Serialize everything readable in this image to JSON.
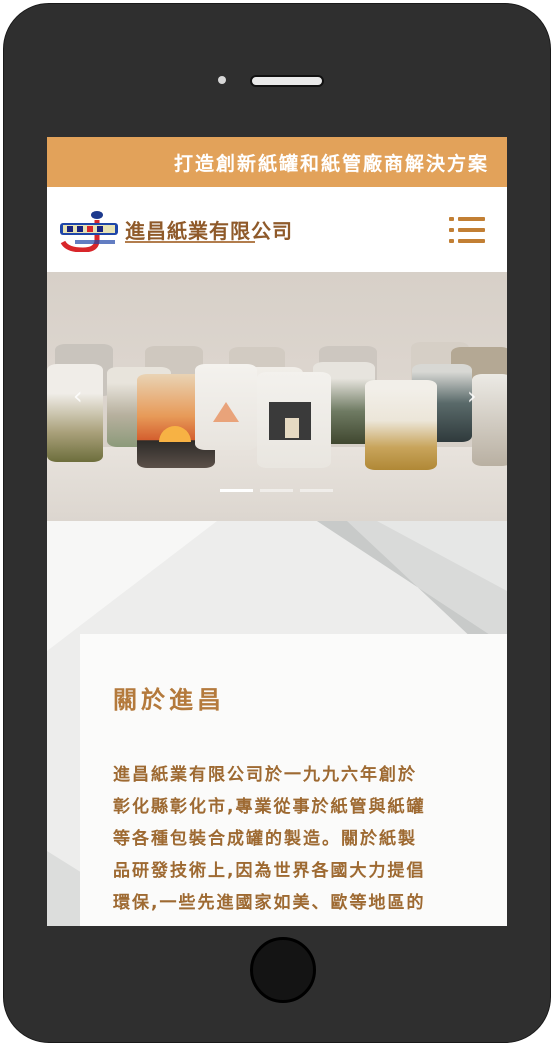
{
  "top_banner": {
    "slogan": "打造創新紙罐和紙管廠商解決方案"
  },
  "header": {
    "logo_text": "進昌紙業有限公司",
    "menu_icon": "hamburger-menu-icon"
  },
  "hero": {
    "prev_icon": "chevron-left-icon",
    "next_icon": "chevron-right-icon",
    "slides_total": 3,
    "active_slide": 1
  },
  "about": {
    "title": "關於進昌",
    "body": "進昌紙業有限公司於一九九六年創於彰化縣彰化市,專業從事於紙管與紙罐等各種包裝合成罐的製造。關於紙製品研發技術上,因為世界各國大力提倡環保,一些先進國家如美、歐等地區的"
  },
  "colors": {
    "accent": "#e2a25a",
    "brown_text": "#9e6a32",
    "menu_icon": "#c27f34"
  }
}
